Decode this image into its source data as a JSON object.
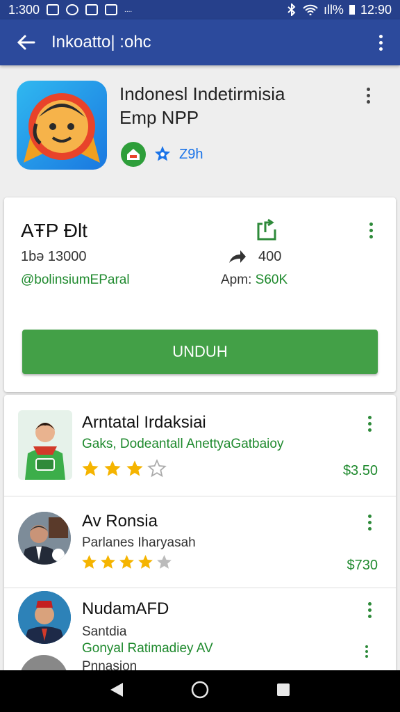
{
  "status_bar": {
    "time_left": "1:300",
    "signal_text": "ıll%",
    "time_right": "12:90",
    "small_text": "...."
  },
  "app_bar": {
    "title": "Inkoatto| :ohc"
  },
  "app_header": {
    "title_line1": "Indonesl Indetirmisia",
    "title_line2": "Emp NPP",
    "badge_text": "Z9h",
    "accent_color": "#2c4a9c"
  },
  "detail_card": {
    "title": "AŦP Ɖlt",
    "size": "1bə 13000",
    "developer_link": "@bolinsiumEParal",
    "count": "400",
    "apm_label": "Apm:",
    "apm_value": "S60K",
    "install_label": "UNDUH",
    "install_color": "#43a047"
  },
  "list": {
    "items": [
      {
        "title": "Arntatal Irdaksiai",
        "subtitle": "Gaks, Dodeantall AnettyaGatbaioy",
        "rating": 3,
        "price": "$3.50"
      },
      {
        "title": "Av Ronsia",
        "subtitle": "Parlanes Iharyasah",
        "rating": 4,
        "price": "$730"
      },
      {
        "title": "NudamAFD",
        "subtitle": "Santdia",
        "subtitle2": "Gonyal Ratimadiey AV",
        "subtitle3": "Pnnasion"
      }
    ]
  }
}
